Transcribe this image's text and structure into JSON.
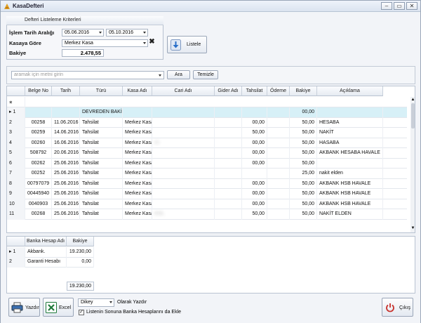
{
  "window": {
    "title": "KasaDefteri"
  },
  "filter": {
    "header": "Defteri Listeleme Kriterleri",
    "date_label": "İşlem Tarih Aralığı",
    "date_from": "05.06.2016",
    "date_to": "05.10.2016",
    "cash_label": "Kasaya Göre",
    "cash_value": "Merkez Kasa",
    "balance_label": "Bakiye",
    "balance_value": "2.478,55",
    "list_button": "Listele"
  },
  "search": {
    "placeholder": "aramak için metni girin",
    "search_button": "Ara",
    "clear_button": "Temizle"
  },
  "grid": {
    "columns": [
      "Belge No",
      "Tarih",
      "Türü",
      "Kasa Adı",
      "Cari Adı",
      "Gider Adı",
      "Tahsilat",
      "Ödeme",
      "Bakiye",
      "Açıklama"
    ],
    "rows": [
      {
        "n": "1",
        "belge": "",
        "tarih": "",
        "turu": "DEVREDEN BAKİYE",
        "kasa": "",
        "cari": "",
        "gider": "",
        "tahsilat": "",
        "odeme": "",
        "bakiye": "00,00",
        "aciklama": ""
      },
      {
        "n": "2",
        "belge": "00258",
        "tarih": "11.06.2016",
        "turu": "Tahsilat",
        "kasa": "Merkez Kasa",
        "cari": "",
        "gider": "",
        "tahsilat": "00,00",
        "odeme": "",
        "bakiye": "50,00",
        "aciklama": "HESABA"
      },
      {
        "n": "3",
        "belge": "00259",
        "tarih": "14.06.2016",
        "turu": "Tahsilat",
        "kasa": "Merkez Kasa",
        "cari": "",
        "gider": "",
        "tahsilat": "50,00",
        "odeme": "",
        "bakiye": "50,00",
        "aciklama": "NAKİT"
      },
      {
        "n": "4",
        "belge": "00260",
        "tarih": "16.06.2016",
        "turu": "Tahsilat",
        "kasa": "Merkez Kasa",
        "cari": "CI",
        "gider": "",
        "tahsilat": "00,00",
        "odeme": "",
        "bakiye": "50,00",
        "aciklama": "HASABA"
      },
      {
        "n": "5",
        "belge": "508792",
        "tarih": "20.06.2016",
        "turu": "Tahsilat",
        "kasa": "Merkez Kasa",
        "cari": "",
        "gider": "",
        "tahsilat": "00,00",
        "odeme": "",
        "bakiye": "50,00",
        "aciklama": "AKBANK HESABA HAVALE"
      },
      {
        "n": "6",
        "belge": "00262",
        "tarih": "25.06.2016",
        "turu": "Tahsilat",
        "kasa": "Merkez Kasa",
        "cari": "",
        "gider": "",
        "tahsilat": "00,00",
        "odeme": "",
        "bakiye": "50,00",
        "aciklama": ""
      },
      {
        "n": "7",
        "belge": "00252",
        "tarih": "25.06.2016",
        "turu": "Tahsilat",
        "kasa": "Merkez Kasa",
        "cari": "",
        "gider": "",
        "tahsilat": "",
        "odeme": "",
        "bakiye": "25,00",
        "aciklama": "nakit elden"
      },
      {
        "n": "8",
        "belge": "00797079",
        "tarih": "25.06.2016",
        "turu": "Tahsilat",
        "kasa": "Merkez Kasa",
        "cari": "",
        "gider": "",
        "tahsilat": "00,00",
        "odeme": "",
        "bakiye": "50,00",
        "aciklama": "AKBANK HSB HAVALE"
      },
      {
        "n": "9",
        "belge": "00445940",
        "tarih": "25.06.2016",
        "turu": "Tahsilat",
        "kasa": "Merkez Kasa",
        "cari": "",
        "gider": "",
        "tahsilat": "00,00",
        "odeme": "",
        "bakiye": "50,00",
        "aciklama": "AKBANK HSB HAVALE"
      },
      {
        "n": "10",
        "belge": "0040903",
        "tarih": "25.06.2016",
        "turu": "Tahsilat",
        "kasa": "Merkez Kasa",
        "cari": "",
        "gider": "",
        "tahsilat": "00,00",
        "odeme": "",
        "bakiye": "50,00",
        "aciklama": "AKBANK HSB HAVALE"
      },
      {
        "n": "11",
        "belge": "00268",
        "tarih": "25.06.2016",
        "turu": "Tahsilat",
        "kasa": "Merkez Kasa",
        "cari": "KOL",
        "gider": "",
        "tahsilat": "50,00",
        "odeme": "",
        "bakiye": "50,00",
        "aciklama": "NAKİT ELDEN"
      }
    ]
  },
  "bank_grid": {
    "columns": [
      "Banka Hesap Adı",
      "Bakiye"
    ],
    "rows": [
      {
        "n": "1",
        "name": "Akbank.",
        "balance": "19.230,00"
      },
      {
        "n": "2",
        "name": "Garanti Hesabı",
        "balance": "0,00"
      }
    ],
    "total": "19.230,00"
  },
  "footer": {
    "print_button": "Yazdır",
    "excel_button": "Excel",
    "orientation_value": "Dikey",
    "orientation_suffix": "Olarak Yazdır",
    "include_banks_label": "Listenin Sonuna Banka Hesaplarını da Ekle",
    "exit_button": "Çıkış"
  },
  "colors": {
    "accent": "#2a6fc9",
    "exit_red": "#c8322d",
    "excel_green": "#1f7a3a",
    "selected_row": "#d7f0f7"
  }
}
